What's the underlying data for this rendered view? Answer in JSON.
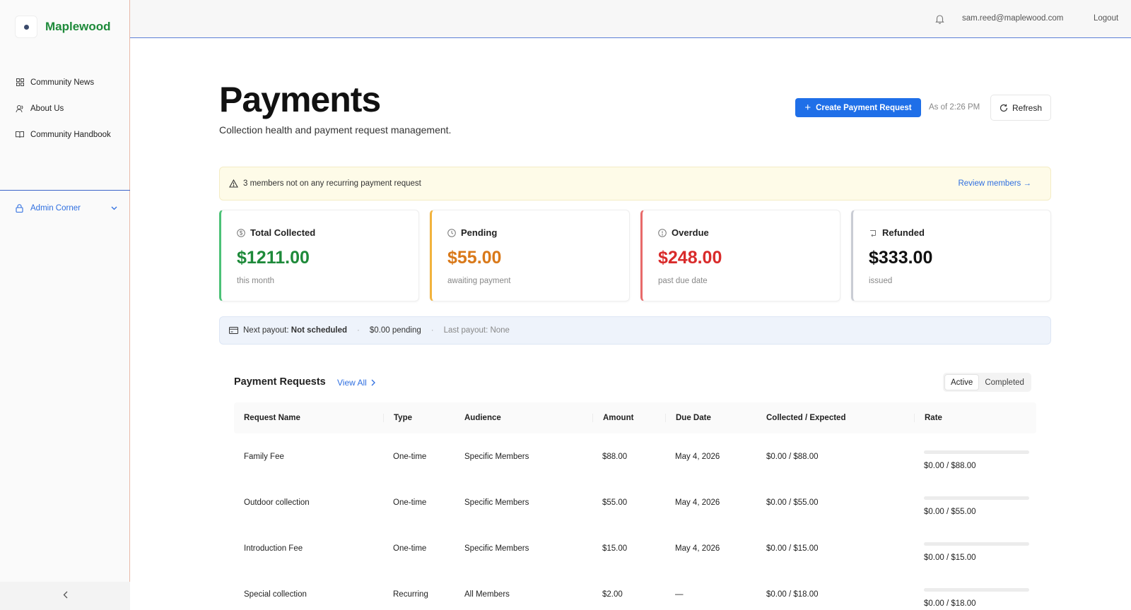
{
  "brand": {
    "name": "Maplewood"
  },
  "sidebar": {
    "items": [
      {
        "label": "Community News",
        "icon": "grid-icon"
      },
      {
        "label": "About Us",
        "icon": "users-icon"
      },
      {
        "label": "Community Handbook",
        "icon": "book-icon"
      }
    ],
    "admin": {
      "label": "Admin Corner",
      "icon": "lock-icon"
    }
  },
  "topbar": {
    "email": "sam.reed@maplewood.com",
    "logout": "Logout"
  },
  "header": {
    "title": "Payments",
    "subtitle": "Collection health and payment request management.",
    "create_button": "Create Payment Request",
    "as_of": "As of 2:26 PM",
    "refresh": "Refresh"
  },
  "alert": {
    "text": "3 members not on any recurring payment request",
    "link": "Review members →"
  },
  "cards": [
    {
      "title": "Total Collected",
      "value": "$1211.00",
      "note": "this month",
      "color": "#1e8a3a",
      "accent": "#4cc277",
      "icon": "dollar-circle-icon"
    },
    {
      "title": "Pending",
      "value": "$55.00",
      "note": "awaiting payment",
      "color": "#d9791a",
      "accent": "#f2b33d",
      "icon": "clock-icon"
    },
    {
      "title": "Overdue",
      "value": "$248.00",
      "note": "past due date",
      "color": "#d92b2b",
      "accent": "#e86a6a",
      "icon": "info-circle-icon"
    },
    {
      "title": "Refunded",
      "value": "$333.00",
      "note": "issued",
      "color": "#111111",
      "accent": "#c9ccd4",
      "icon": "refund-icon"
    }
  ],
  "payout": {
    "label": "Next payout:",
    "status": "Not scheduled",
    "pending": "$0.00 pending",
    "last": "Last payout: None",
    "sep": "·"
  },
  "requests": {
    "title": "Payment Requests",
    "view_all": "View All",
    "tabs": [
      "Active",
      "Completed"
    ],
    "active_tab": "Active",
    "columns": [
      "Request Name",
      "Type",
      "Audience",
      "Amount",
      "Due Date",
      "Collected / Expected",
      "Rate"
    ],
    "rows": [
      {
        "name": "Family Fee",
        "type": "One-time",
        "audience": "Specific Members",
        "amount": "$88.00",
        "due": "May 4, 2026",
        "collected": "$0.00 / $88.00",
        "rate": "$0.00 / $88.00",
        "rate_fraction": 0
      },
      {
        "name": "Outdoor collection",
        "type": "One-time",
        "audience": "Specific Members",
        "amount": "$55.00",
        "due": "May 4, 2026",
        "collected": "$0.00 / $55.00",
        "rate": "$0.00 / $55.00",
        "rate_fraction": 0
      },
      {
        "name": "Introduction Fee",
        "type": "One-time",
        "audience": "Specific Members",
        "amount": "$15.00",
        "due": "May 4, 2026",
        "collected": "$0.00 / $15.00",
        "rate": "$0.00 / $15.00",
        "rate_fraction": 0
      },
      {
        "name": "Special collection",
        "type": "Recurring",
        "audience": "All Members",
        "amount": "$2.00",
        "due": "—",
        "collected": "$0.00 / $18.00",
        "rate": "$0.00 / $18.00",
        "rate_fraction": 0
      }
    ]
  }
}
